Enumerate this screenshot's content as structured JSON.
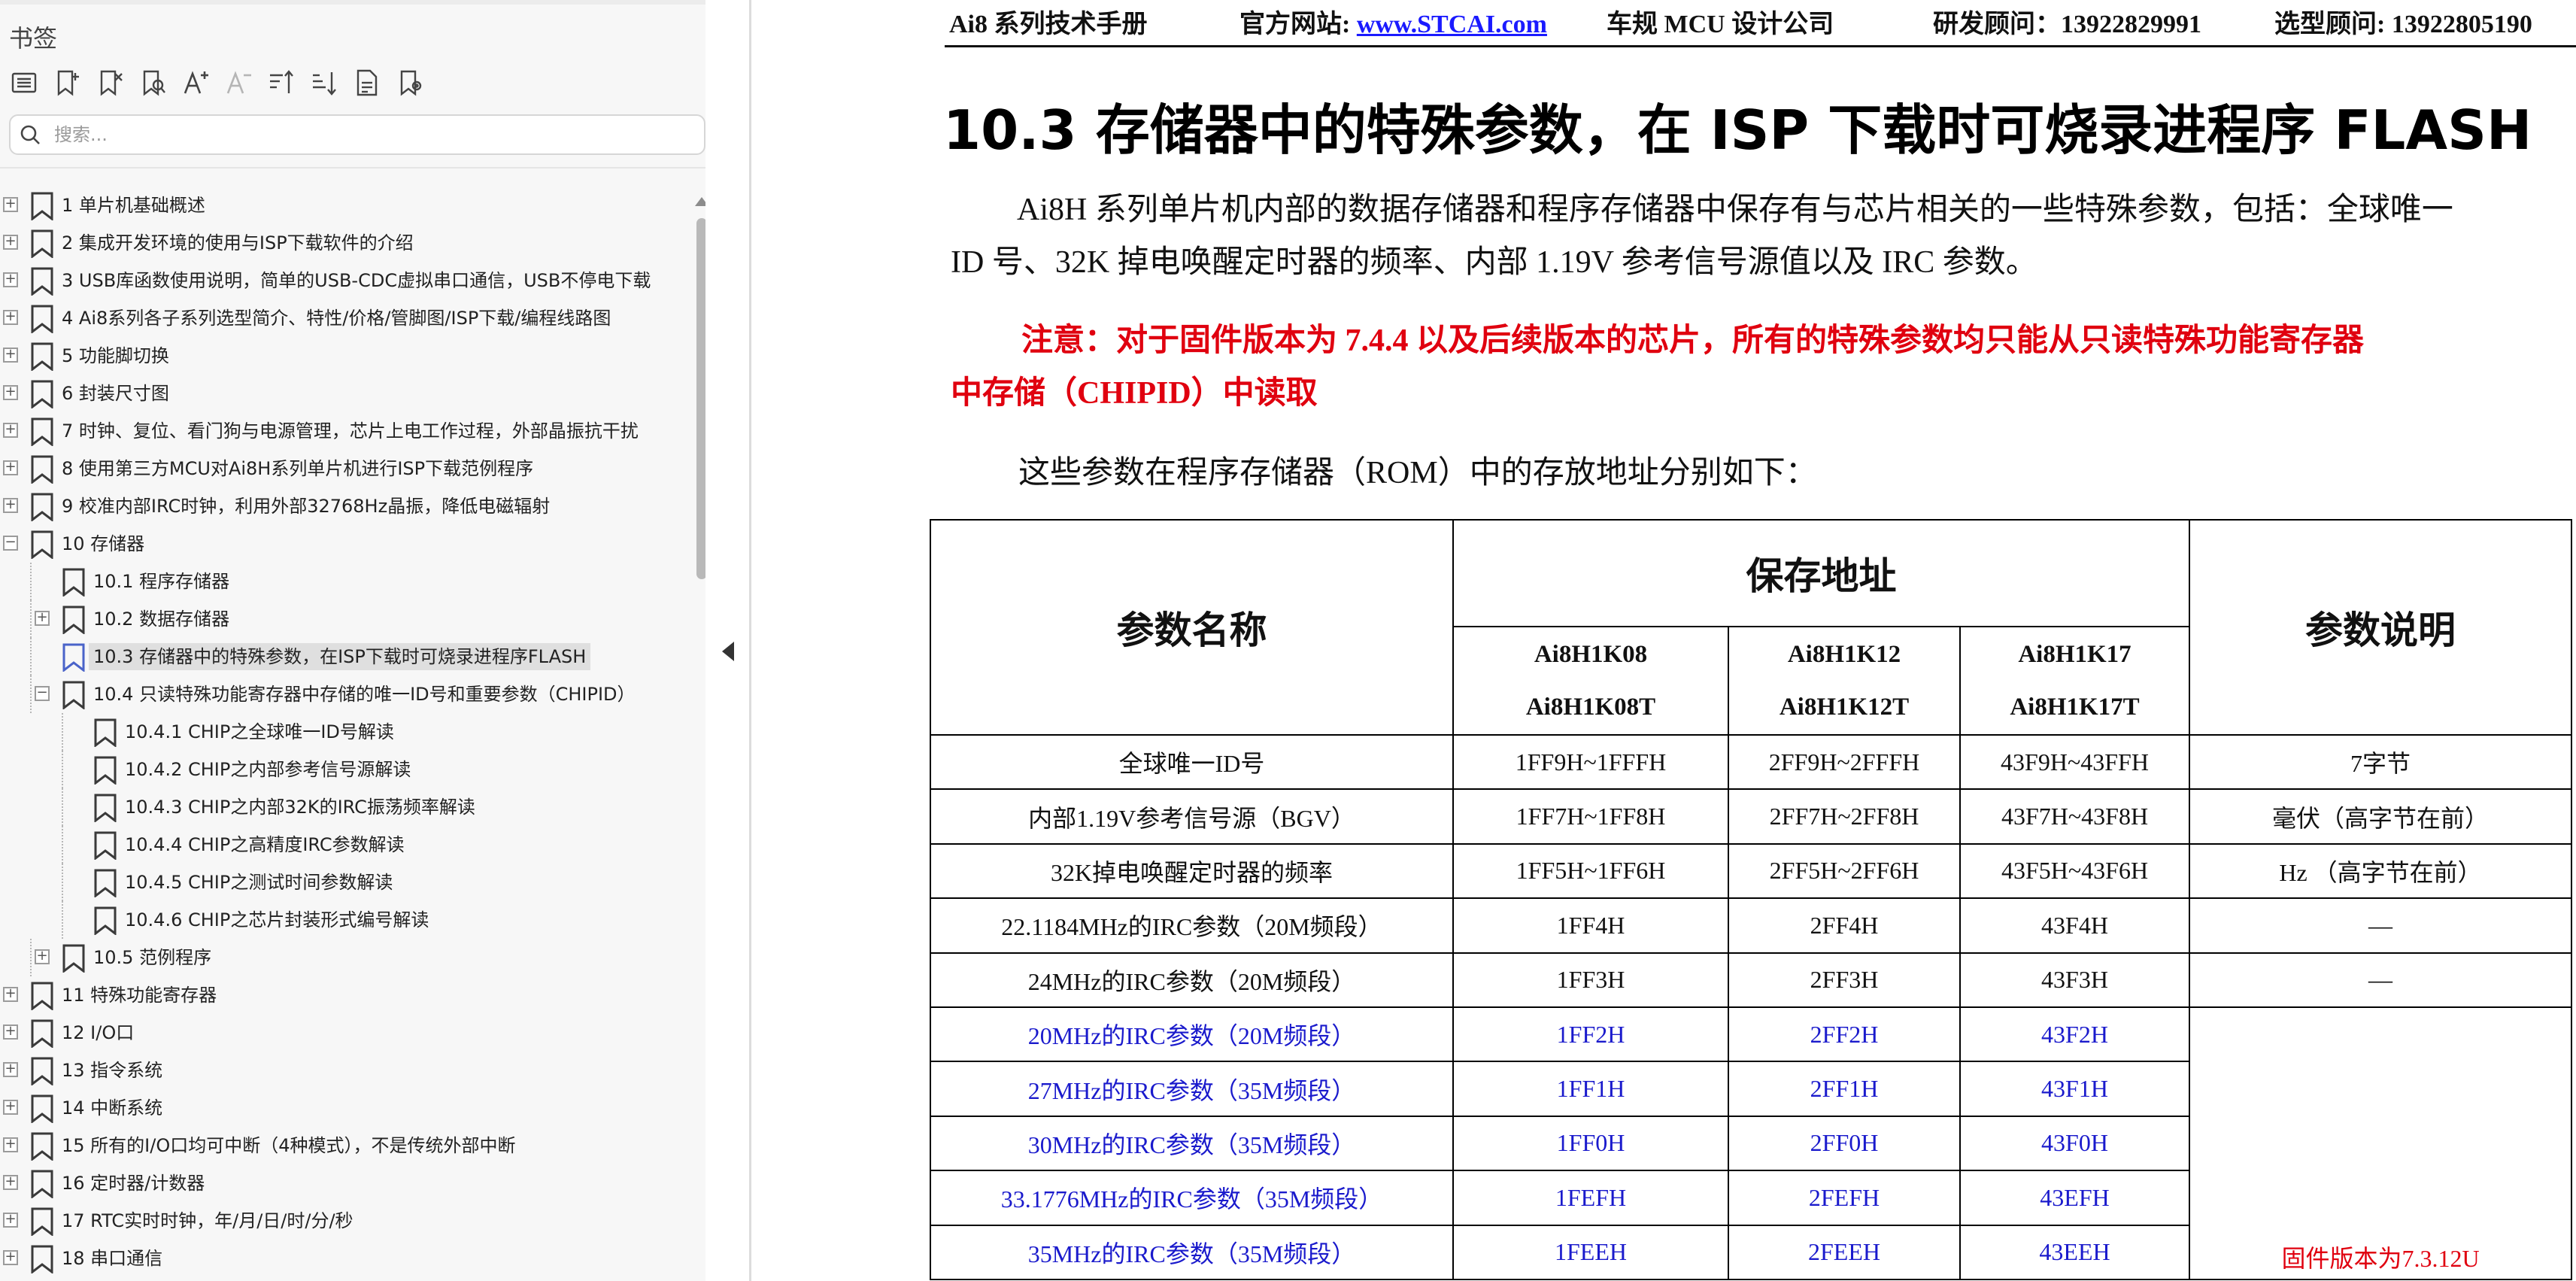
{
  "sidebar": {
    "title": "书签",
    "toolbar_icons": [
      "expand-all-icon",
      "add-bookmark-icon",
      "delete-bookmark-icon",
      "find-bookmark-icon",
      "text-larger-icon",
      "text-smaller-icon",
      "sort-ascending-icon",
      "sort-descending-icon",
      "properties-icon",
      "bookmark-settings-icon"
    ],
    "search_placeholder": "搜索...",
    "items": [
      {
        "label": "1 单片机基础概述",
        "level": 0,
        "expander": "+"
      },
      {
        "label": "2  集成开发环境的使用与ISP下载软件的介绍",
        "level": 0,
        "expander": "+"
      },
      {
        "label": "3  USB库函数使用说明，简单的USB-CDC虚拟串口通信，USB不停电下载",
        "level": 0,
        "expander": "+"
      },
      {
        "label": "4  Ai8系列各子系列选型简介、特性/价格/管脚图/ISP下载/编程线路图",
        "level": 0,
        "expander": "+"
      },
      {
        "label": "5  功能脚切换",
        "level": 0,
        "expander": "+"
      },
      {
        "label": "6  封装尺寸图",
        "level": 0,
        "expander": "+"
      },
      {
        "label": "7  时钟、复位、看门狗与电源管理，芯片上电工作过程，外部晶振抗干扰",
        "level": 0,
        "expander": "+"
      },
      {
        "label": "8  使用第三方MCU对Ai8H系列单片机进行ISP下载范例程序",
        "level": 0,
        "expander": "+"
      },
      {
        "label": "9  校准内部IRC时钟，利用外部32768Hz晶振，降低电磁辐射",
        "level": 0,
        "expander": "+"
      },
      {
        "label": "10  存储器",
        "level": 0,
        "expander": "-"
      },
      {
        "label": "10.1 程序存储器",
        "level": 1,
        "expander": ""
      },
      {
        "label": "10.2  数据存储器",
        "level": 1,
        "expander": "+"
      },
      {
        "label": "10.3  存储器中的特殊参数，在ISP下载时可烧录进程序FLASH",
        "level": 1,
        "expander": "",
        "selected": true
      },
      {
        "label": "10.4  只读特殊功能寄存器中存储的唯一ID号和重要参数（CHIPID）",
        "level": 1,
        "expander": "-"
      },
      {
        "label": "10.4.1  CHIP之全球唯一ID号解读",
        "level": 2,
        "expander": ""
      },
      {
        "label": "10.4.2 CHIP之内部参考信号源解读",
        "level": 2,
        "expander": ""
      },
      {
        "label": "10.4.3 CHIP之内部32K的IRC振荡频率解读",
        "level": 2,
        "expander": ""
      },
      {
        "label": "10.4.4  CHIP之高精度IRC参数解读",
        "level": 2,
        "expander": ""
      },
      {
        "label": "10.4.5  CHIP之测试时间参数解读",
        "level": 2,
        "expander": ""
      },
      {
        "label": "10.4.6 CHIP之芯片封装形式编号解读",
        "level": 2,
        "expander": ""
      },
      {
        "label": "10.5  范例程序",
        "level": 1,
        "expander": "+"
      },
      {
        "label": "11  特殊功能寄存器",
        "level": 0,
        "expander": "+"
      },
      {
        "label": "12  I/O口",
        "level": 0,
        "expander": "+"
      },
      {
        "label": "13  指令系统",
        "level": 0,
        "expander": "+"
      },
      {
        "label": "14  中断系统",
        "level": 0,
        "expander": "+"
      },
      {
        "label": "15  所有的I/O口均可中断（4种模式），不是传统外部中断",
        "level": 0,
        "expander": "+"
      },
      {
        "label": "16  定时器/计数器",
        "level": 0,
        "expander": "+"
      },
      {
        "label": "17  RTC实时时钟，年/月/日/时/分/秒",
        "level": 0,
        "expander": "+"
      },
      {
        "label": "18  串口通信",
        "level": 0,
        "expander": "+"
      }
    ]
  },
  "document": {
    "header": {
      "manual": "Ai8 系列技术手册",
      "site_prefix": "官方网站: ",
      "site_link": "www.STCAI.com",
      "company": "车规 MCU 设计公司",
      "rd_consultant": "研发顾问：13922829991",
      "selection_consultant": "选型顾问: 13922805190"
    },
    "section_title": "10.3 存储器中的特殊参数，在 ISP 下载时可烧录进程序 FLASH",
    "intro_line1": "Ai8H 系列单片机内部的数据存储器和程序存储器中保存有与芯片相关的一些特殊参数，包括：全球唯一",
    "intro_line2": "ID 号、32K 掉电唤醒定时器的频率、内部 1.19V 参考信号源值以及 IRC 参数。",
    "notice_line1": "注意：对于固件版本为 7.4.4 以及后续版本的芯片，所有的特殊参数均只能从只读特殊功能寄存器",
    "notice_line2": "中存储（CHIPID）中读取",
    "rom_intro": "这些参数在程序存储器（ROM）中的存放地址分别如下：",
    "colors": {
      "notice_red": "#e0000f",
      "blue_rows": "#1a1acc",
      "link_blue": "#1a1aff"
    },
    "table": {
      "col_param_name": "参数名称",
      "col_address": "保存地址",
      "col_description": "参数说明",
      "models": [
        {
          "line1": "Ai8H1K08",
          "line2": "Ai8H1K08T"
        },
        {
          "line1": "Ai8H1K12",
          "line2": "Ai8H1K12T"
        },
        {
          "line1": "Ai8H1K17",
          "line2": "Ai8H1K17T"
        }
      ],
      "rows": [
        {
          "name": "全球唯一ID号",
          "a1": "1FF9H~1FFFH",
          "a2": "2FF9H~2FFFH",
          "a3": "43F9H~43FFH",
          "desc": "7字节",
          "blue": false
        },
        {
          "name": "内部1.19V参考信号源（BGV）",
          "a1": "1FF7H~1FF8H",
          "a2": "2FF7H~2FF8H",
          "a3": "43F7H~43F8H",
          "desc": "毫伏（高字节在前）",
          "blue": false
        },
        {
          "name": "32K掉电唤醒定时器的频率",
          "a1": "1FF5H~1FF6H",
          "a2": "2FF5H~2FF6H",
          "a3": "43F5H~43F6H",
          "desc": "Hz （高字节在前）",
          "blue": false
        },
        {
          "name": "22.1184MHz的IRC参数（20M频段）",
          "a1": "1FF4H",
          "a2": "2FF4H",
          "a3": "43F4H",
          "desc": "—",
          "blue": false
        },
        {
          "name": "24MHz的IRC参数（20M频段）",
          "a1": "1FF3H",
          "a2": "2FF3H",
          "a3": "43F3H",
          "desc": "—",
          "blue": false
        },
        {
          "name": "20MHz的IRC参数（20M频段）",
          "a1": "1FF2H",
          "a2": "2FF2H",
          "a3": "43F2H",
          "desc": "",
          "blue": true
        },
        {
          "name": "27MHz的IRC参数（35M频段）",
          "a1": "1FF1H",
          "a2": "2FF1H",
          "a3": "43F1H",
          "desc": "",
          "blue": true
        },
        {
          "name": "30MHz的IRC参数（35M频段）",
          "a1": "1FF0H",
          "a2": "2FF0H",
          "a3": "43F0H",
          "desc": "",
          "blue": true
        },
        {
          "name": "33.1776MHz的IRC参数（35M频段）",
          "a1": "1FEFH",
          "a2": "2FEFH",
          "a3": "43EFH",
          "desc": "",
          "blue": true
        },
        {
          "name": "35MHz的IRC参数（35M频段）",
          "a1": "1FEEH",
          "a2": "2FEEH",
          "a3": "43EEH",
          "desc": "",
          "blue": true
        }
      ],
      "merged_note": "固件版本为7.3.12U"
    }
  }
}
